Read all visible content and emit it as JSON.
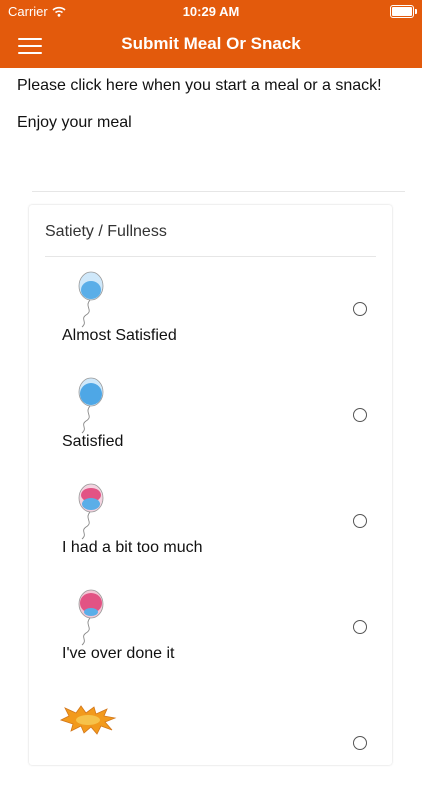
{
  "status_bar": {
    "carrier": "Carrier",
    "time": "10:29 AM"
  },
  "header": {
    "title": "Submit Meal Or Snack"
  },
  "intro": {
    "instruction": "Please click here when you start a meal or a snack!",
    "message": "Enjoy your meal"
  },
  "card": {
    "title": "Satiety / Fullness",
    "options": [
      {
        "label": "Almost Satisfied",
        "icon": "blue-balloon-icon",
        "selected": false
      },
      {
        "label": "Satisfied",
        "icon": "blue-balloon-icon",
        "selected": false
      },
      {
        "label": "I had a bit too much",
        "icon": "pink-blue-balloon-icon",
        "selected": false
      },
      {
        "label": "I've over done it",
        "icon": "pink-balloon-icon",
        "selected": false
      },
      {
        "label": "",
        "icon": "boom-burst-icon",
        "selected": false
      }
    ]
  },
  "colors": {
    "header": "#e35a0c",
    "balloon_blue": "#5aaee8",
    "balloon_pink": "#e25384",
    "burst": "#f29a1c"
  }
}
